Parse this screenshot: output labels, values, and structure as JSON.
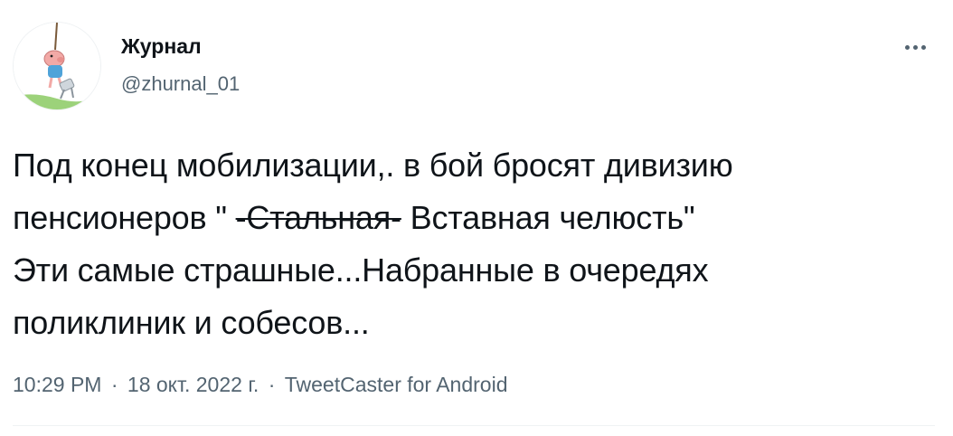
{
  "author": {
    "display_name": "Журнал",
    "handle": "@zhurnal_01",
    "avatar_icon": "cartoon-pig-avatar-icon"
  },
  "more_icon": "ellipsis-icon",
  "tweet": {
    "line1": "Под конец мобилизации,. в бой бросят дивизию",
    "line2_before": "пенсионеров \" ",
    "line2_struck": "-Стальная-",
    "line2_after": " Вставная челюсть\"",
    "line3": "Эти самые страшные...Набранные в очередях",
    "line4": "поликлиник и собесов..."
  },
  "meta": {
    "time": "10:29 PM",
    "separator": "·",
    "date": "18 окт. 2022 г.",
    "source": "TweetCaster for Android"
  },
  "colors": {
    "text": "#0f1419",
    "secondary": "#536471"
  }
}
